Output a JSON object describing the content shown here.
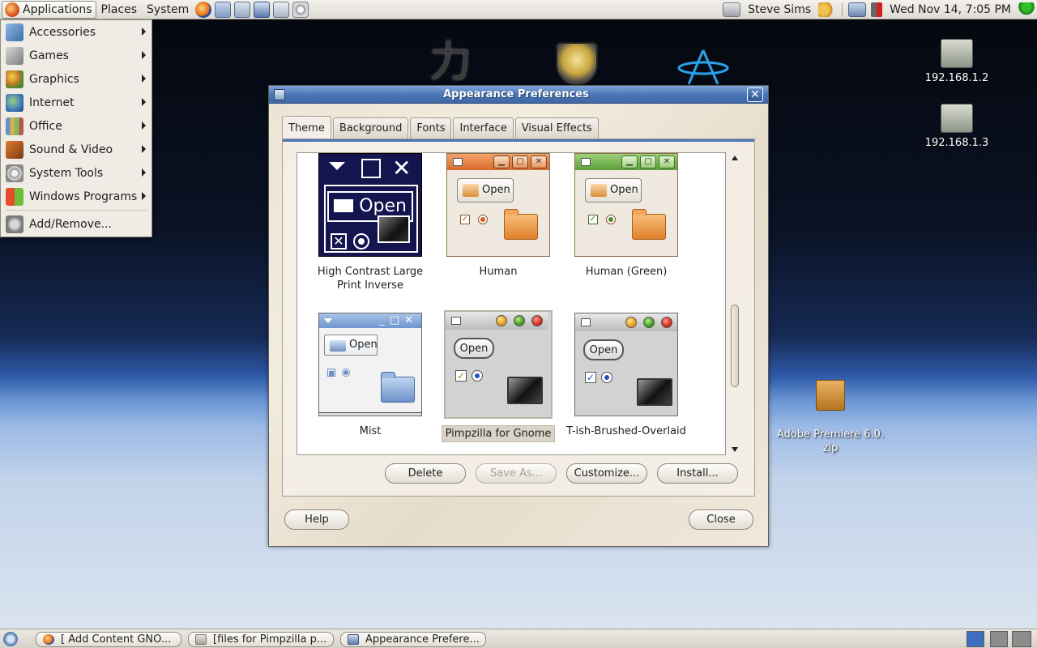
{
  "top_panel": {
    "menus": [
      "Applications",
      "Places",
      "System"
    ],
    "user": "Steve Sims",
    "clock": "Wed Nov 14,  7:05 PM"
  },
  "app_menu": {
    "items": [
      {
        "label": "Accessories",
        "icon": "accessories-icon",
        "submenu": true
      },
      {
        "label": "Games",
        "icon": "games-icon",
        "submenu": true
      },
      {
        "label": "Graphics",
        "icon": "graphics-icon",
        "submenu": true
      },
      {
        "label": "Internet",
        "icon": "internet-icon",
        "submenu": true
      },
      {
        "label": "Office",
        "icon": "office-icon",
        "submenu": true
      },
      {
        "label": "Sound & Video",
        "icon": "sound-video-icon",
        "submenu": true
      },
      {
        "label": "System Tools",
        "icon": "system-tools-icon",
        "submenu": true
      },
      {
        "label": "Windows Programs",
        "icon": "windows-programs-icon",
        "submenu": true
      }
    ],
    "extra": "Add/Remove..."
  },
  "desktop": {
    "icons": [
      {
        "label": "192.168.1.2",
        "icon": "network-drive-icon"
      },
      {
        "label": "192.168.1.3",
        "icon": "network-drive-icon"
      },
      {
        "label": "Adobe Premiere 6.0.\nzip",
        "icon": "zip-archive-icon"
      }
    ]
  },
  "window": {
    "title": "Appearance Preferences",
    "tabs": [
      "Theme",
      "Background",
      "Fonts",
      "Interface",
      "Visual Effects"
    ],
    "active_tab": "Theme",
    "themes": [
      {
        "name": "High Contrast Large Print Inverse",
        "preview_text": "Open"
      },
      {
        "name": "Human",
        "preview_text": "Open"
      },
      {
        "name": "Human (Green)",
        "preview_text": "Open"
      },
      {
        "name": "Mist",
        "preview_text": "Open"
      },
      {
        "name": "Pimpzilla for Gnome",
        "preview_text": "Open",
        "selected": true
      },
      {
        "name": "T-ish-Brushed-Overlaid",
        "preview_text": "Open"
      }
    ],
    "buttons": {
      "delete": "Delete",
      "save_as": "Save As...",
      "customize": "Customize...",
      "install": "Install...",
      "help": "Help",
      "close": "Close"
    }
  },
  "taskbar": {
    "items": [
      {
        "label": "[ Add Content GNO...",
        "icon": "firefox-icon"
      },
      {
        "label": "[files for Pimpzilla p...",
        "icon": "file-manager-icon"
      },
      {
        "label": "Appearance Prefere...",
        "icon": "appearance-icon"
      }
    ]
  }
}
